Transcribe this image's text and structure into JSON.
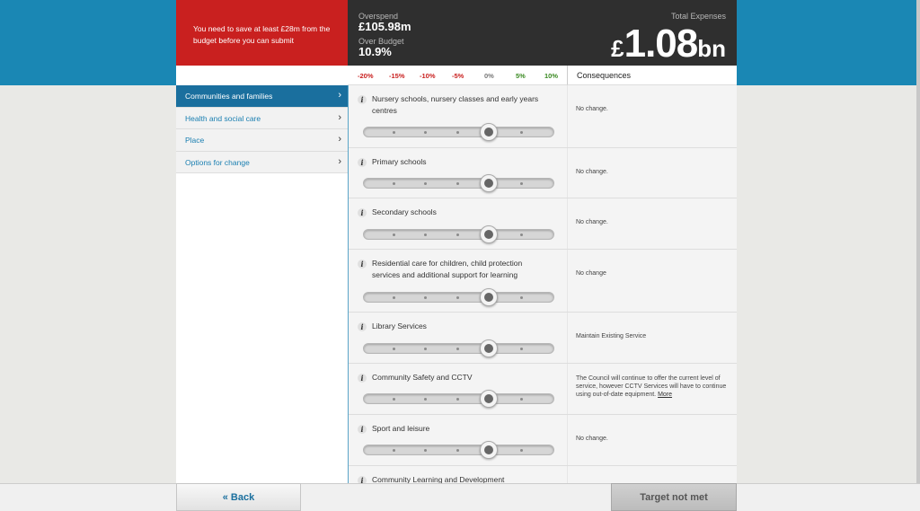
{
  "alert": {
    "text": "You need to save at least £28m from the budget before you can submit"
  },
  "stats": {
    "overspend_label": "Overspend",
    "overspend_value": "£105.98m",
    "over_budget_label": "Over Budget",
    "over_budget_value": "10.9%",
    "total_label": "Total Expenses",
    "total_currency": "£",
    "total_number": "1.08",
    "total_unit": "bn"
  },
  "scale": {
    "labels": [
      "-20%",
      "-15%",
      "-10%",
      "-5%",
      "0%",
      "5%",
      "10%"
    ]
  },
  "consequences_header": "Consequences",
  "sidebar": {
    "items": [
      {
        "label": "Communities and families",
        "active": true
      },
      {
        "label": "Health and social care",
        "active": false
      },
      {
        "label": "Place",
        "active": false
      },
      {
        "label": "Options for change",
        "active": false
      }
    ]
  },
  "services": [
    {
      "title": "Nursery schools, nursery classes and early years centres",
      "consequence": "No change.",
      "change_percent": 0
    },
    {
      "title": "Primary schools",
      "consequence": "No change.",
      "change_percent": 0
    },
    {
      "title": "Secondary schools",
      "consequence": "No change.",
      "change_percent": 0
    },
    {
      "title": "Residential care for children, child protection services and additional support for learning",
      "consequence": "No change",
      "change_percent": 0
    },
    {
      "title": "Library Services",
      "consequence": "Maintain Existing Service",
      "change_percent": 0
    },
    {
      "title": "Community Safety and CCTV",
      "consequence": "The Council will continue to offer the current level of service, however CCTV Services will have to continue using out-of-date equipment.",
      "more_link": "More",
      "change_percent": 0
    },
    {
      "title": "Sport and leisure",
      "consequence": "No change.",
      "change_percent": 0
    },
    {
      "title": "Community Learning and Development",
      "consequence": "",
      "change_percent": 0
    }
  ],
  "info_icon_glyph": "i",
  "chevron_glyph": "›",
  "footer": {
    "back_label": "«  Back",
    "target_label": "Target not met"
  },
  "colors": {
    "accent_blue": "#1a87b4",
    "alert_red": "#c9201f",
    "stats_dark": "#2f2f2f"
  }
}
